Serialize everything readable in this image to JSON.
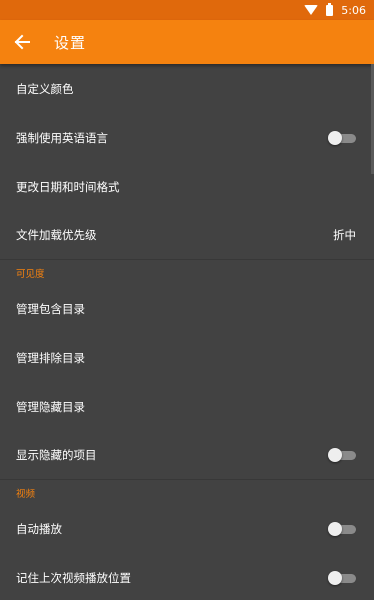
{
  "status_bar": {
    "time": "5:06"
  },
  "app_bar": {
    "title": "设置"
  },
  "settings": {
    "custom_colors": "自定义颜色",
    "force_english": {
      "label": "强制使用英语语言",
      "enabled": false
    },
    "date_time_format": "更改日期和时间格式",
    "file_loading_priority": {
      "label": "文件加载优先级",
      "value": "折中"
    }
  },
  "visibility": {
    "header": "可见度",
    "manage_included": "管理包含目录",
    "manage_excluded": "管理排除目录",
    "manage_hidden": "管理隐藏目录",
    "show_hidden": {
      "label": "显示隐藏的项目",
      "enabled": false
    }
  },
  "video": {
    "header": "视频",
    "autoplay": {
      "label": "自动播放",
      "enabled": false
    },
    "remember_position": {
      "label": "记住上次视频播放位置",
      "enabled": false
    }
  },
  "colors": {
    "accent": "#F5820F",
    "statusbar": "#E0690C",
    "background": "#424242"
  },
  "icons": {
    "back": "arrow-left-icon",
    "wifi": "wifi-icon",
    "battery": "battery-icon"
  }
}
